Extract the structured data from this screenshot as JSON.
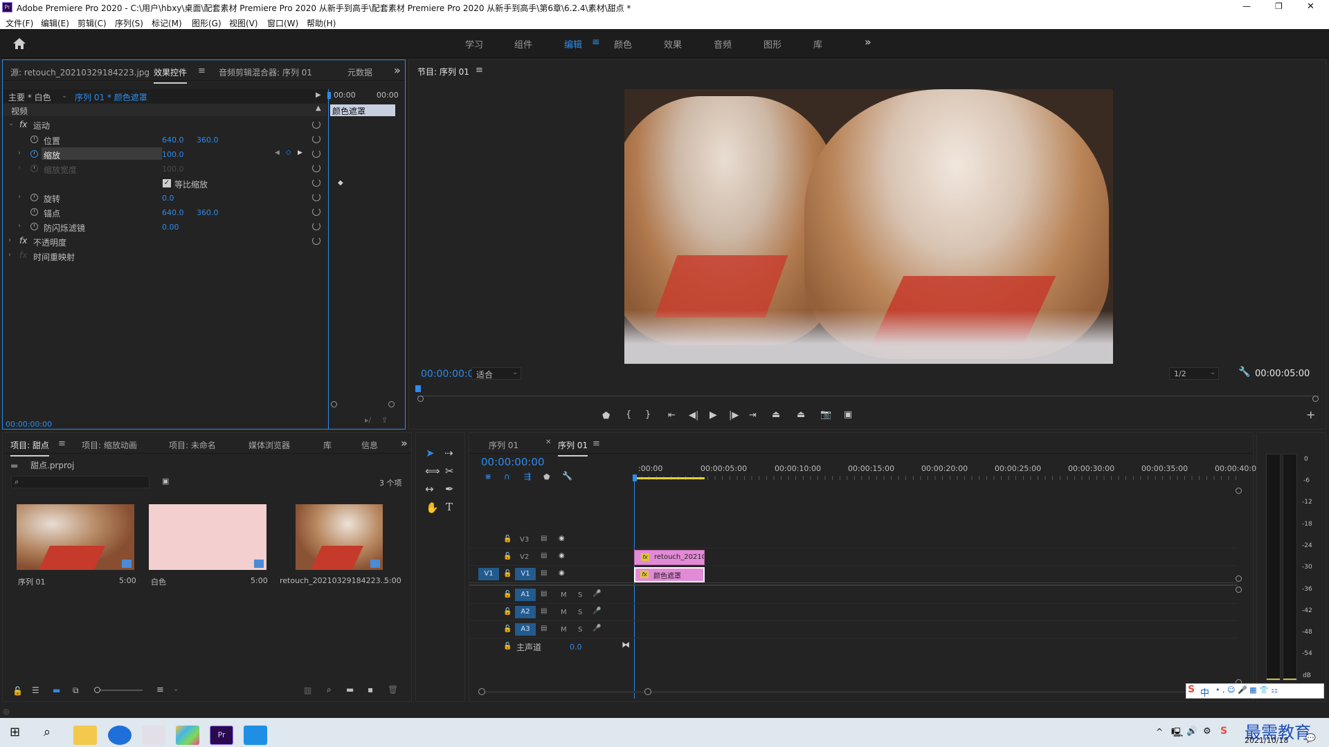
{
  "window": {
    "title": "Adobe Premiere Pro 2020 - C:\\用户\\hbxy\\桌面\\配套素材 Premiere Pro 2020 从新手到高手\\配套素材 Premiere Pro 2020 从新手到高手\\第6章\\6.2.4\\素材\\甜点 *",
    "minimize": "—",
    "maximize": "❐",
    "close": "✕"
  },
  "menu": [
    "文件(F)",
    "编辑(E)",
    "剪辑(C)",
    "序列(S)",
    "标记(M)",
    "图形(G)",
    "视图(V)",
    "窗口(W)",
    "帮助(H)"
  ],
  "workspaces": {
    "items": [
      "学习",
      "组件",
      "编辑",
      "颜色",
      "效果",
      "音频",
      "图形",
      "库"
    ],
    "active": "编辑",
    "more": "»"
  },
  "source_panel": {
    "tabs": [
      "源: retouch_20210329184223.jpg",
      "效果控件",
      "音频剪辑混合器: 序列 01",
      "元数据"
    ],
    "master": "主要 * 白色",
    "clip": "序列 01 * 颜色遮罩",
    "time_start": "00:00",
    "time_end": "00:00",
    "clip_label": "颜色遮罩",
    "video_header": "视频",
    "fx_label": "fx",
    "motion": "运动",
    "position_label": "位置",
    "position_x": "640.0",
    "position_y": "360.0",
    "scale_label": "缩放",
    "scale_val": "100.0",
    "scale_width_label": "缩放宽度",
    "scale_width_val": "100.0",
    "uniform_label": "等比缩放",
    "rotation_label": "旋转",
    "rotation_val": "0.0",
    "anchor_label": "锚点",
    "anchor_x": "640.0",
    "anchor_y": "360.0",
    "flicker_label": "防闪烁滤镜",
    "flicker_val": "0.00",
    "opacity": "不透明度",
    "time_remap": "时间重映射",
    "timecode": "00:00:00:00"
  },
  "program_monitor": {
    "title": "节目: 序列 01",
    "timecode": "00:00:00:00",
    "fit": "适合",
    "resolution": "1/2",
    "duration": "00:00:05:00"
  },
  "project_panel": {
    "tabs": [
      "项目: 甜点",
      "项目: 缩放动画",
      "项目: 未命名",
      "媒体浏览器",
      "库",
      "信息"
    ],
    "file": "甜点.prproj",
    "count": "3 个项",
    "items": [
      {
        "name": "序列 01",
        "duration": "5:00"
      },
      {
        "name": "白色",
        "duration": "5:00"
      },
      {
        "name": "retouch_20210329184223...",
        "duration": "5:00"
      }
    ]
  },
  "timeline": {
    "tabs": [
      "序列 01",
      "序列 01"
    ],
    "timecode": "00:00:00:00",
    "ruler": [
      ":00:00",
      "00:00:05:00",
      "00:00:10:00",
      "00:00:15:00",
      "00:00:20:00",
      "00:00:25:00",
      "00:00:30:00",
      "00:00:35:00",
      "00:00:40:00"
    ],
    "video_tracks": [
      "V3",
      "V2",
      "V1"
    ],
    "audio_tracks": [
      "A1",
      "A2",
      "A3"
    ],
    "master_label": "主声道",
    "master_val": "0.0",
    "source_patch": "V1",
    "clip_v2": "retouch_2021032",
    "clip_v1": "颜色遮罩",
    "m": "M",
    "s": "S"
  },
  "meter": {
    "scale": [
      "0",
      "-6",
      "-12",
      "-18",
      "-24",
      "-30",
      "-36",
      "-42",
      "-48",
      "-54",
      "dB"
    ],
    "s_left": "S",
    "s_right": "S"
  },
  "taskbar": {
    "date": "2021/10/18",
    "watermark": "最需教育",
    "ime": "中"
  },
  "colors": {
    "accent": "#2d8ceb",
    "clip_pink": "#e38ad7",
    "matte_pink": "#f3cfcf",
    "playhead_yellow": "#e0d13a"
  }
}
